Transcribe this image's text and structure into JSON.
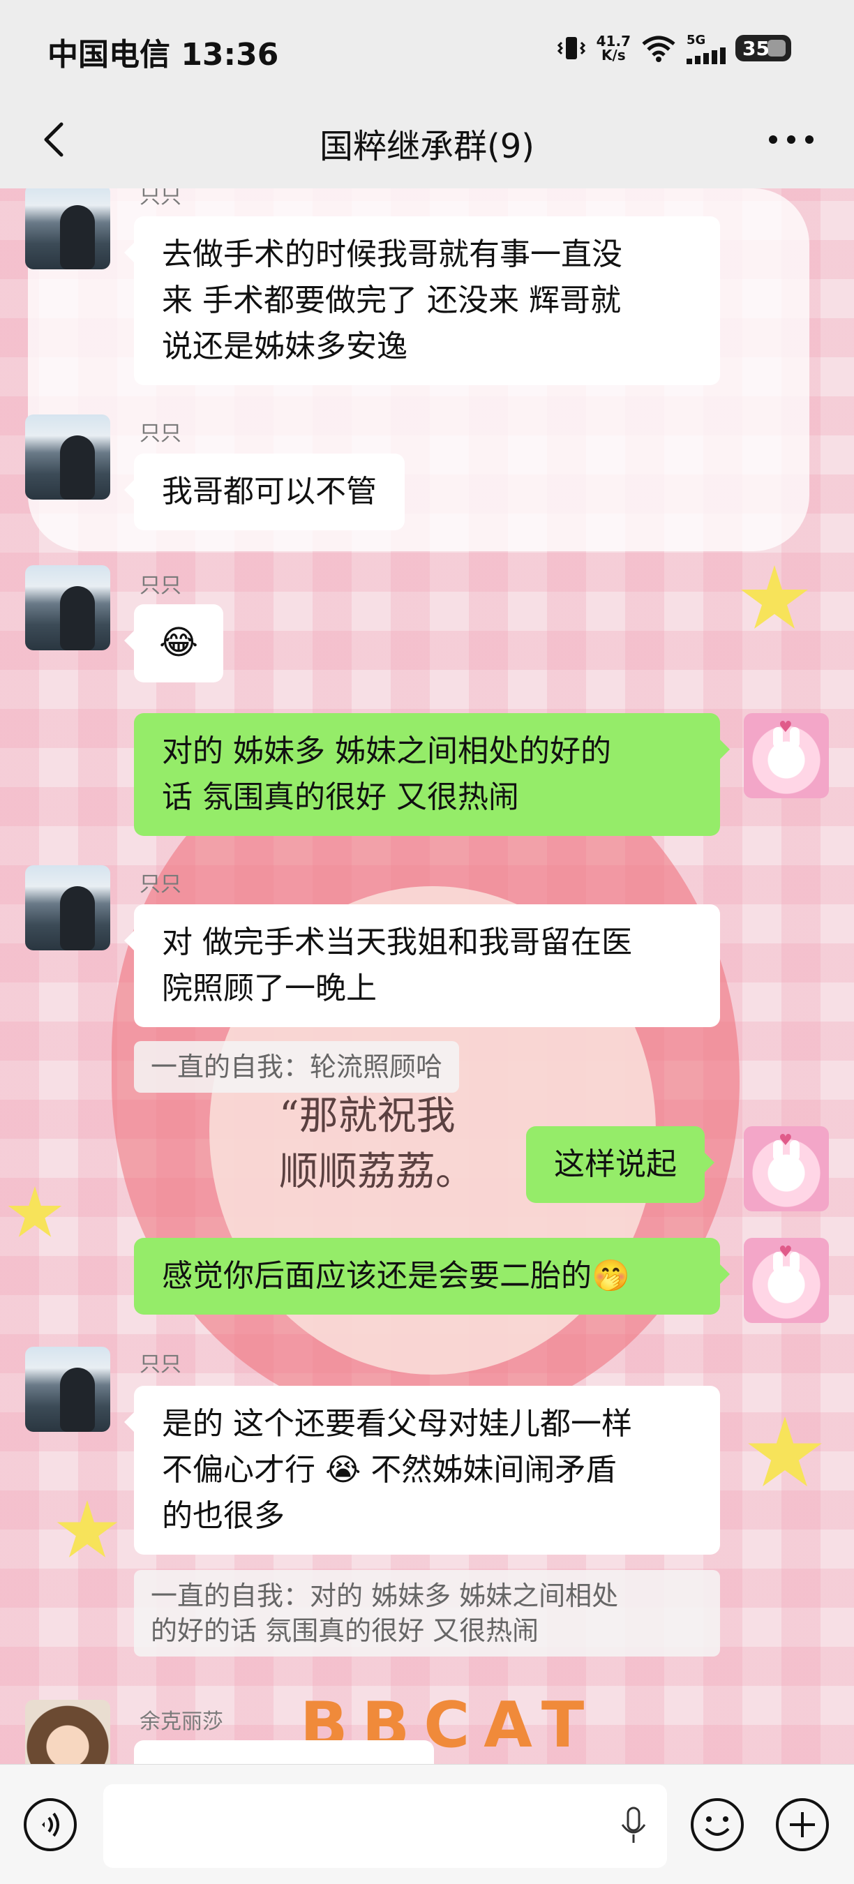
{
  "status_bar": {
    "carrier_time": "中国电信 13:36",
    "net_speed_value": "41.7",
    "net_speed_unit": "K/s",
    "signal_label": "5G",
    "battery": "35"
  },
  "nav": {
    "title": "国粹继承群(9)"
  },
  "background_text": {
    "handwriting_line1": "“那就祝我",
    "handwriting_line2": "顺顺荔荔。",
    "brand": "BBCAT"
  },
  "messages": [
    {
      "sender": "只只",
      "text_lines": [
        "去做手术的时候我哥就有事一直没",
        "来 手术都要做完了 还没来 辉哥就",
        "说还是姊妹多安逸"
      ]
    },
    {
      "sender": "只只",
      "text": "我哥都可以不管"
    },
    {
      "sender": "只只",
      "emoji": "😂"
    },
    {
      "sender": "me",
      "text_lines": [
        "对的 姊妹多 姊妹之间相处的好的",
        "话 氛围真的很好 又很热闹"
      ]
    },
    {
      "sender": "只只",
      "text_lines": [
        "对 做完手术当天我姐和我哥留在医",
        "院照顾了一晚上"
      ],
      "quote": "一直的自我：轮流照顾哈"
    },
    {
      "sender": "me",
      "text": "这样说起"
    },
    {
      "sender": "me",
      "text": "感觉你后面应该还是会要二胎的🤭"
    },
    {
      "sender": "只只",
      "text_lines": [
        "是的 这个还要看父母对娃儿都一样",
        "不偏心才行 😭 不然姊妹间闹矛盾",
        "的也很多"
      ],
      "quote_lines": [
        "一直的自我：对的 姊妹多 姊妹之间相处",
        "的好的话 氛围真的很好 又很热闹"
      ]
    },
    {
      "sender": "余克丽莎"
    }
  ],
  "colors": {
    "my_bubble": "#95ec69",
    "their_bubble": "#ffffff",
    "bar_bg": "#ededed"
  },
  "icons": {
    "back": "chevron-left-icon",
    "more": "more-dots-icon",
    "voice": "voice-toggle-icon",
    "mic": "microphone-icon",
    "emoji": "emoji-icon",
    "plus": "plus-icon"
  }
}
